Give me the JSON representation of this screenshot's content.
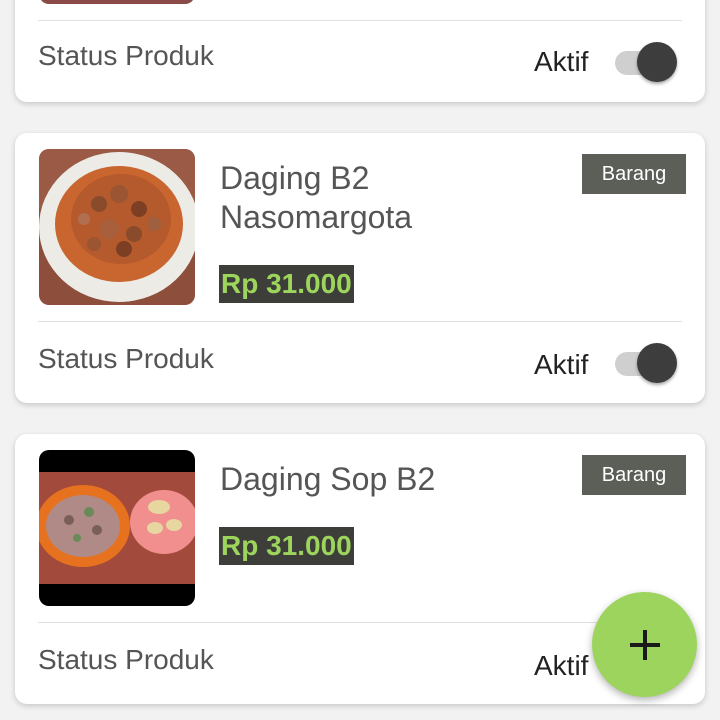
{
  "status_label": "Status Produk",
  "aktif_label": "Aktif",
  "products": [
    {
      "name": "Daging B2 Nasomargota",
      "price": "Rp 31.000",
      "badge": "Barang",
      "status": "Aktif",
      "active": true,
      "image_icon": "food-photo-b2"
    },
    {
      "name": "Daging Sop B2",
      "price": "Rp 31.000",
      "badge": "Barang",
      "status": "Aktif",
      "active": true,
      "image_icon": "food-photo-sop"
    }
  ],
  "fab_icon": "plus-icon",
  "colors": {
    "accent": "#9dd45e",
    "price_bg": "#3d3e3a",
    "badge_bg": "#5c5e58",
    "toggle_knob": "#3d3d3d"
  }
}
